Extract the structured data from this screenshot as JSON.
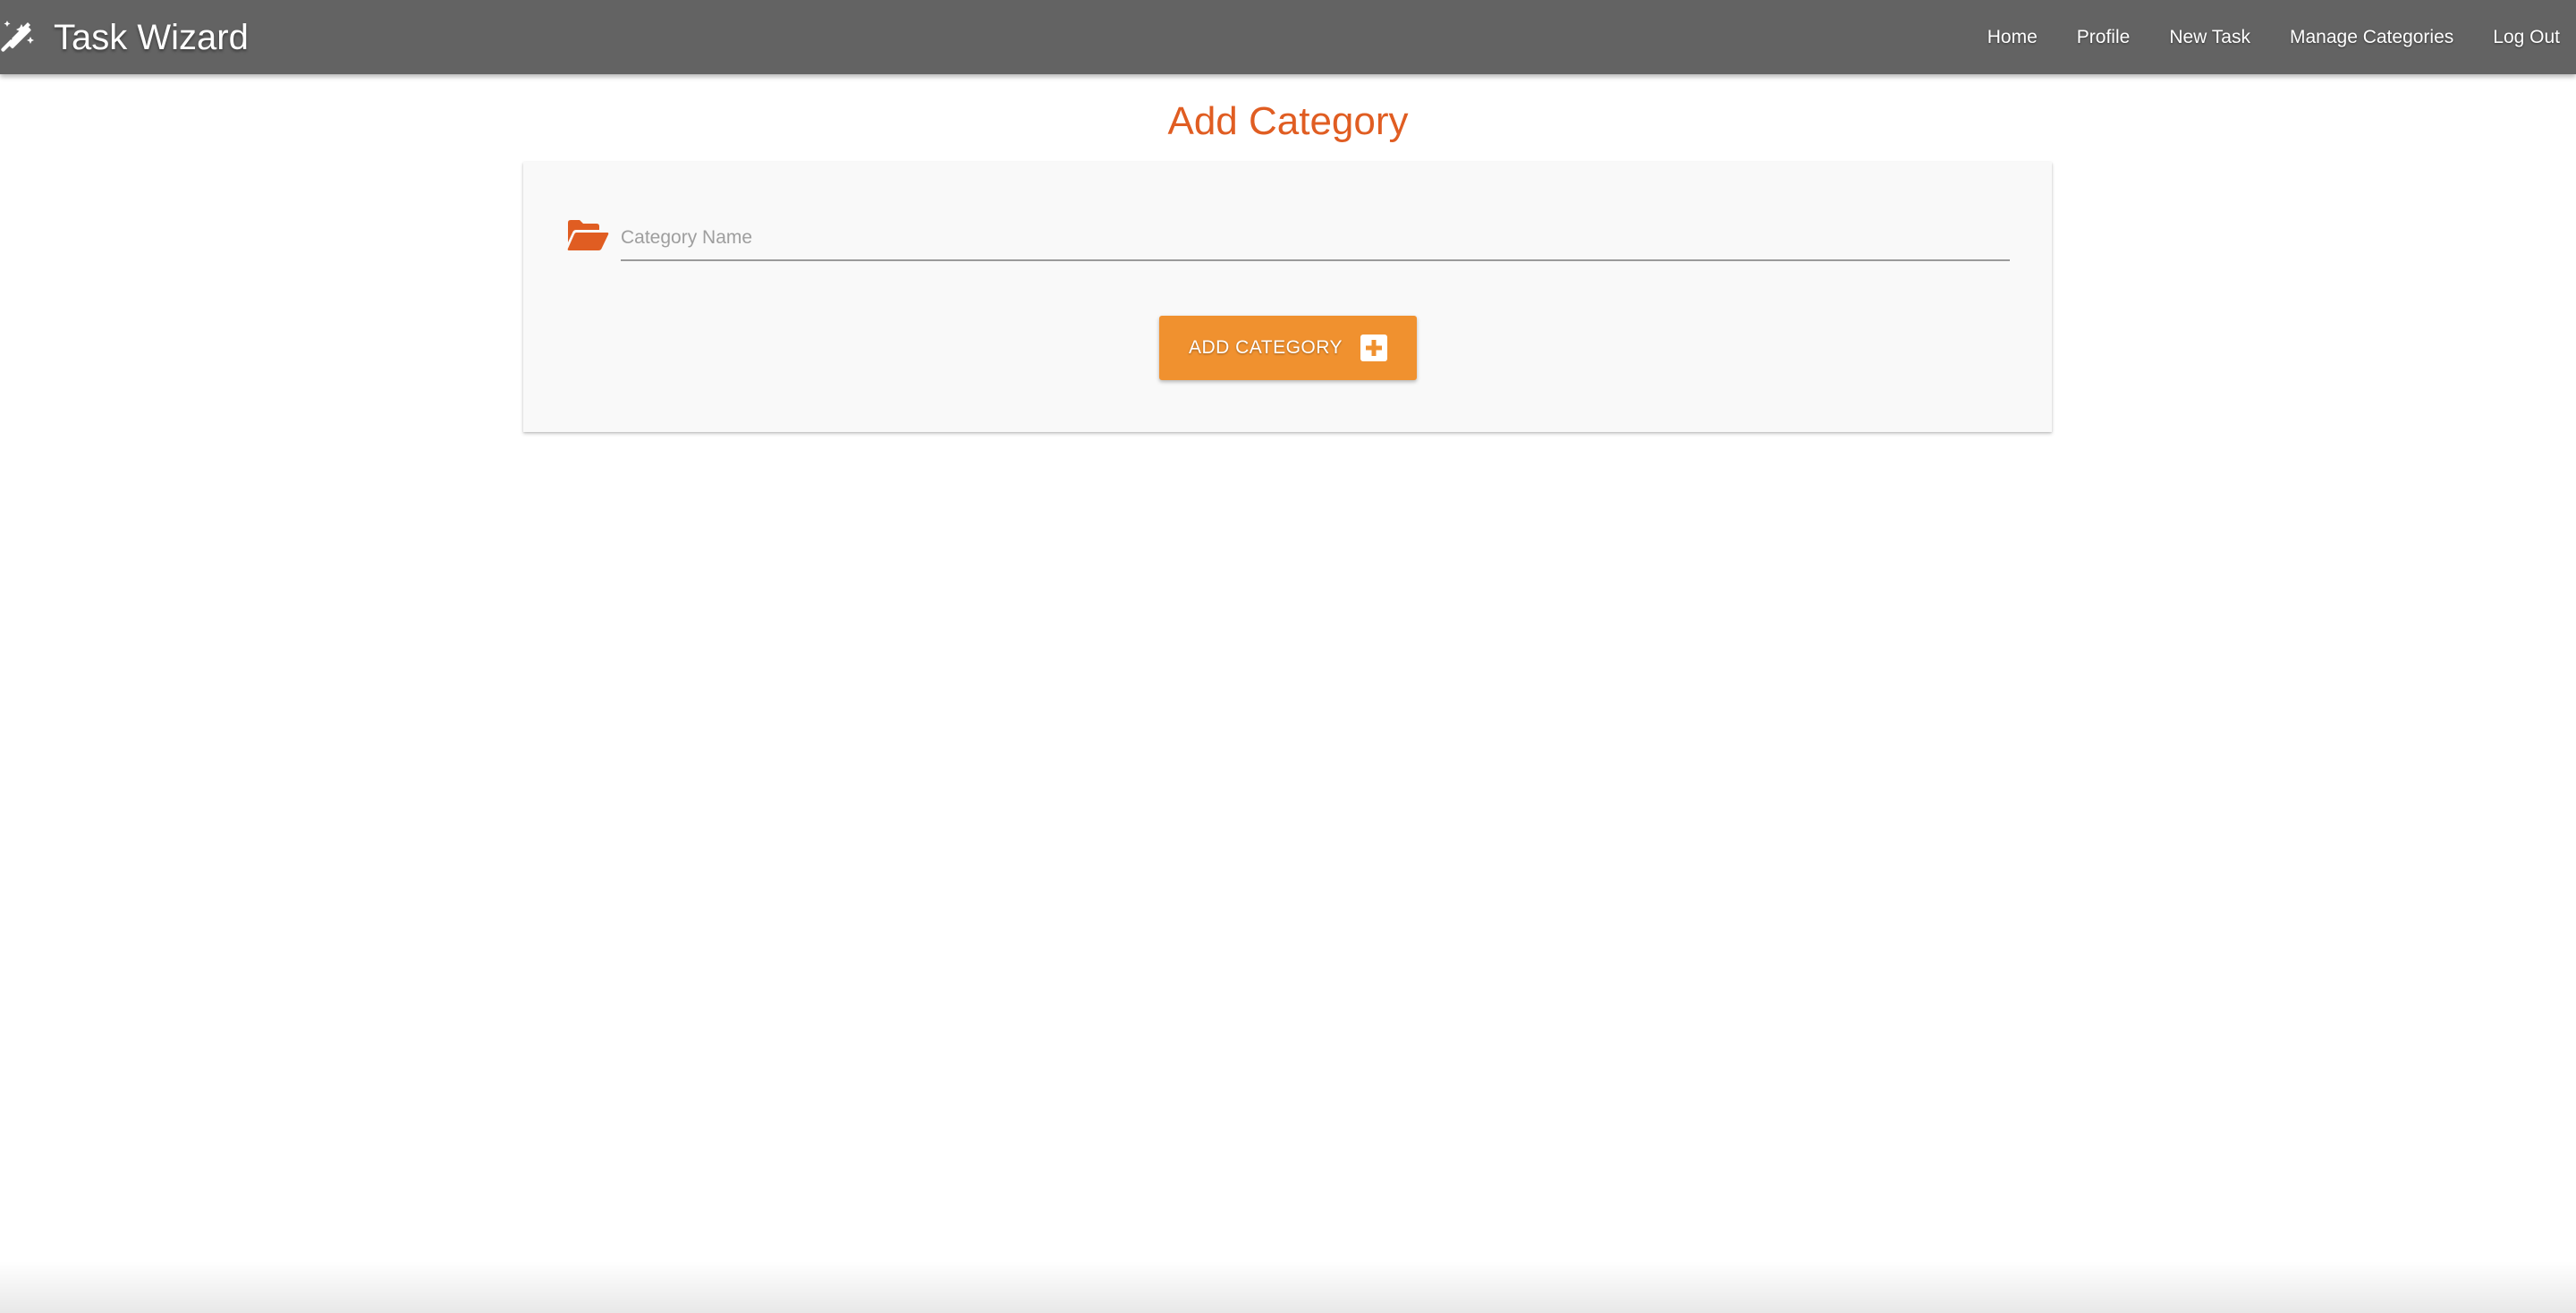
{
  "navbar": {
    "brand_icon": "magic-wand-icon",
    "brand_text": "Task Wizard",
    "links": [
      {
        "label": "Home"
      },
      {
        "label": "Profile"
      },
      {
        "label": "New Task"
      },
      {
        "label": "Manage Categories"
      },
      {
        "label": "Log Out"
      }
    ],
    "background_color": "#636363"
  },
  "page": {
    "title": "Add Category",
    "title_color": "#e05d22"
  },
  "form": {
    "field_icon": "folder-open-icon",
    "category_name": {
      "value": "",
      "placeholder": "Category Name"
    },
    "submit": {
      "label": "ADD CATEGORY",
      "icon": "plus-square-icon",
      "color": "#f0912f"
    }
  }
}
